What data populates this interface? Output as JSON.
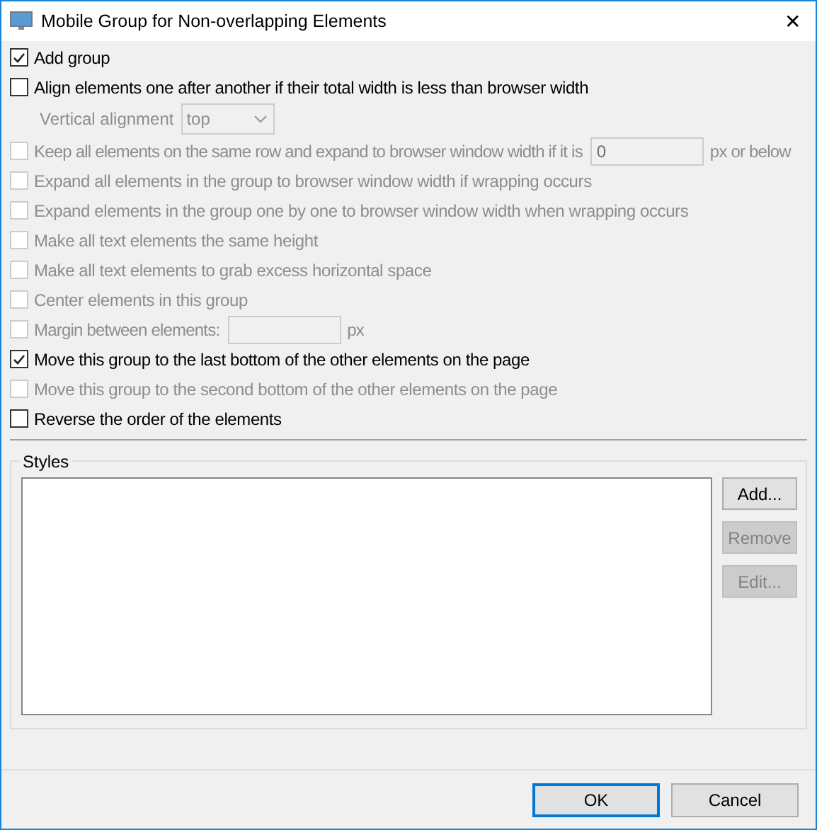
{
  "window": {
    "title": "Mobile Group for Non-overlapping Elements",
    "close": "✕"
  },
  "options": [
    {
      "kind": "checkbox",
      "label": "Add group",
      "checked": true,
      "disabled": false
    },
    {
      "kind": "checkbox",
      "label": "Align elements one after another if their total width is less than browser width",
      "checked": false,
      "disabled": false
    },
    {
      "kind": "select",
      "label": "Vertical alignment",
      "value": "top",
      "disabled": true
    },
    {
      "kind": "checkbox-field",
      "label": "Keep all elements on the same row and expand to browser window width if it is",
      "value": "0",
      "suffix": "px or below",
      "checked": false,
      "disabled": true
    },
    {
      "kind": "checkbox",
      "label": "Expand all elements in the group to browser window width if wrapping occurs",
      "checked": false,
      "disabled": true
    },
    {
      "kind": "checkbox",
      "label": "Expand elements in the group one by one to browser window width when wrapping occurs",
      "checked": false,
      "disabled": true
    },
    {
      "kind": "checkbox",
      "label": "Make all text elements the same height",
      "checked": false,
      "disabled": true
    },
    {
      "kind": "checkbox",
      "label": "Make all text elements to grab excess horizontal space",
      "checked": false,
      "disabled": true
    },
    {
      "kind": "checkbox",
      "label": "Center elements in this group",
      "checked": false,
      "disabled": true
    },
    {
      "kind": "checkbox-field",
      "label": "Margin between elements:",
      "suffix": "px",
      "checked": false,
      "disabled": true
    },
    {
      "kind": "checkbox",
      "label": "Move this group to the last bottom of the other elements on the page",
      "checked": true,
      "disabled": false
    },
    {
      "kind": "checkbox",
      "label": "Move this group to the second bottom of the other elements on the page",
      "checked": false,
      "disabled": true
    },
    {
      "kind": "checkbox",
      "label": "Reverse the order of the elements",
      "checked": false,
      "disabled": false
    }
  ],
  "styles": {
    "title": "Styles",
    "buttons": [
      {
        "label": "Add...",
        "disabled": false
      },
      {
        "label": "Remove",
        "disabled": true
      },
      {
        "label": "Edit...",
        "disabled": true
      }
    ]
  },
  "buttons": [
    {
      "label": "OK",
      "default": true
    },
    {
      "label": "Cancel",
      "default": false
    }
  ]
}
